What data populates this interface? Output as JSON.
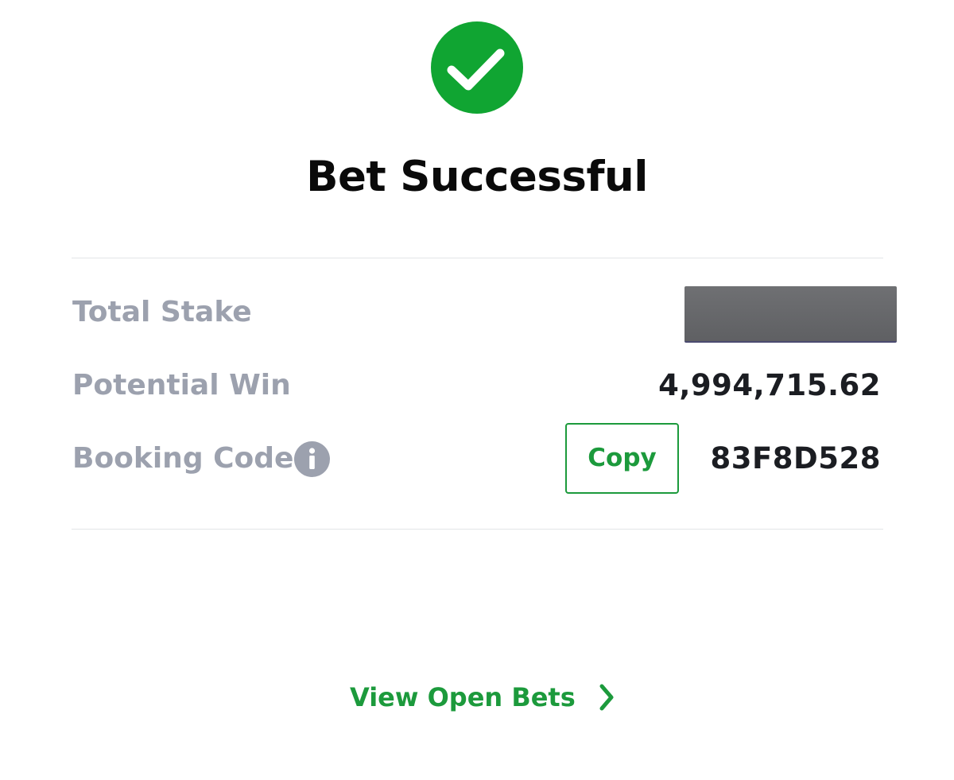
{
  "header": {
    "status_icon": "check-circle-icon",
    "title": "Bet Successful"
  },
  "summary": {
    "total_stake": {
      "label": "Total Stake",
      "value": ""
    },
    "potential_win": {
      "label": "Potential Win",
      "value": "4,994,715.62"
    },
    "booking_code": {
      "label": "Booking Code",
      "info_icon": "info-icon",
      "copy_label": "Copy",
      "value": "83F8D528"
    }
  },
  "footer": {
    "view_open_bets_label": "View Open Bets",
    "chevron_icon": "chevron-right-icon"
  },
  "colors": {
    "success_green": "#10a532",
    "accent_green": "#1c9a3c",
    "label_gray": "#9ca1ae",
    "value_dark": "#1b1d22"
  }
}
